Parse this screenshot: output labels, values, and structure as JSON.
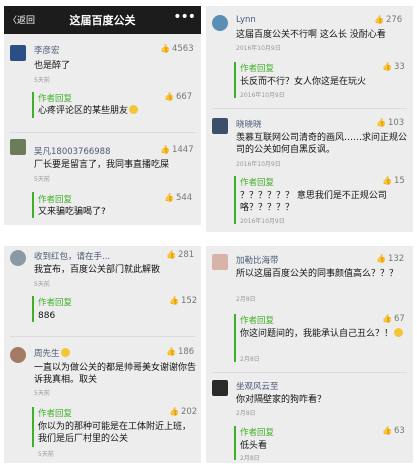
{
  "header": {
    "back_label": "〈返回",
    "title": "这届百度公关",
    "more_label": "•••"
  },
  "panel1": {
    "c1": {
      "user": "李彦宏",
      "likes": "4563",
      "text": "也是醉了",
      "time": "5天前"
    },
    "r1": {
      "label": "作者回复",
      "likes": "667",
      "text": "心疼评论区的某些朋友"
    },
    "c2": {
      "user": "吴凡18003766988",
      "likes": "1447",
      "text": "厂长要是留言了，我同事直播吃屎",
      "time": "5天前"
    },
    "r2": {
      "label": "作者回复",
      "likes": "544",
      "text": "又来骗吃骗喝了?"
    }
  },
  "panel2": {
    "c1": {
      "user": "Lynn",
      "likes": "276",
      "text": "这届百度公关不行啊 这么长 没耐心看",
      "time": "2016年10月9日"
    },
    "r1": {
      "label": "作者回复",
      "likes": "33",
      "text": "长反而不行？女人你这是在玩火",
      "time": "2016年10月9日"
    },
    "c2": {
      "user": "晓晓晓",
      "likes": "103",
      "text": "羡慕互联网公司清奇的画风……求问正规公司的公关如何自黑反讽。",
      "time": "2016年10月9日"
    },
    "r2": {
      "label": "作者回复",
      "likes": "15",
      "text": "？？？？？？ 意思我们是不正规公司咯？？？？？",
      "time": "2016年10月9日"
    }
  },
  "panel3": {
    "c1": {
      "user": "收到红包，请在手...",
      "likes": "281",
      "text": "我宣布，百度公关部门就此解散",
      "time": "5天前"
    },
    "r1": {
      "label": "作者回复",
      "likes": "152",
      "text": "886"
    },
    "c2": {
      "user": "周先生",
      "likes": "186",
      "text": "一直以为做公关的都是帅哥美女谢谢你告诉我真相。取关",
      "time": "5天前"
    },
    "r2": {
      "label": "作者回复",
      "likes": "202",
      "text": "你以为的那种可能是在工体附近上班，我们是后厂村里的公关",
      "time": "5天前"
    }
  },
  "panel4": {
    "c1": {
      "user": "加勒比海带",
      "likes": "132",
      "text": "所以这届百度公关的同事颜值高么？？？",
      "time": "2月8日"
    },
    "r1": {
      "label": "作者回复",
      "likes": "67",
      "text": "你这问题间的，我能承认自己丑么？！",
      "time": "2月8日"
    },
    "c2": {
      "user": "坐观风云至",
      "likes": "",
      "text": "你对隔壁家的狗咋看？",
      "time": "2月8日"
    },
    "r2": {
      "label": "作者回复",
      "likes": "63",
      "text": "低头看",
      "time": "2月8日"
    }
  },
  "colors": {
    "topbar": "#1c1c1c",
    "panel_bg": "#ededed",
    "reply_green": "#3fae29",
    "username": "#4a5a78"
  }
}
